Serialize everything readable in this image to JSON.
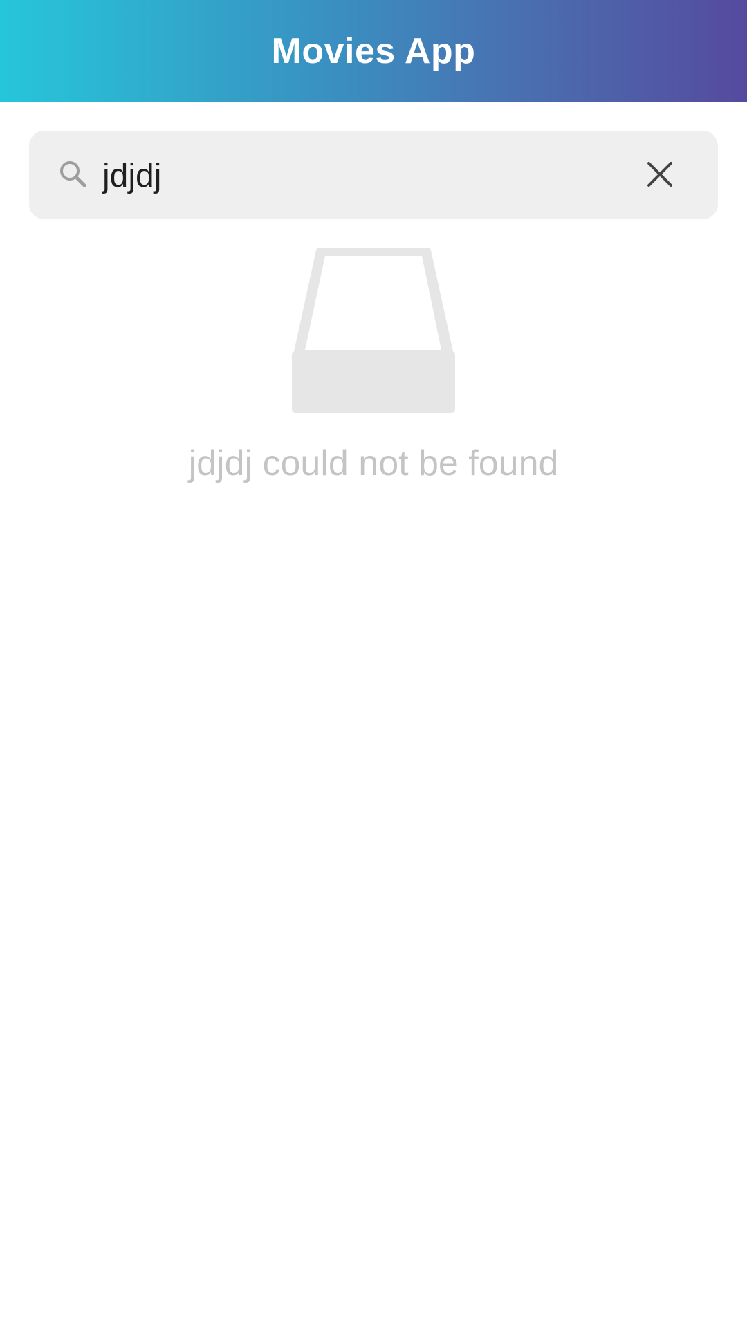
{
  "app": {
    "title": "Movies App"
  },
  "search": {
    "value": "jdjdj",
    "icon": "search-icon",
    "clear_icon": "close-icon"
  },
  "empty_state": {
    "icon": "empty-inbox-icon",
    "message": "jdjdj could not be found"
  },
  "colors": {
    "header_gradient_start": "#26c6da",
    "header_gradient_end": "#554a9f",
    "search_background": "#efefef",
    "empty_text": "#c4c4c4",
    "empty_icon": "#e6e6e6"
  }
}
